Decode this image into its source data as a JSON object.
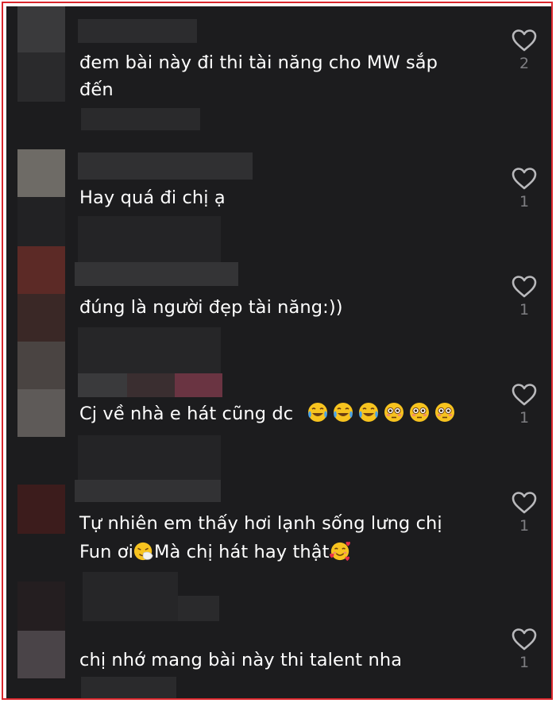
{
  "comments": [
    {
      "text": "đem bài này đi thi tài năng cho MW sắp",
      "text2": "đến",
      "likes": "2"
    },
    {
      "text": "Hay quá đi chị ạ",
      "likes": "1"
    },
    {
      "text": "đúng là người đẹp tài năng:))",
      "likes": "1"
    },
    {
      "text": "Cj về nhà e hát cũng dc",
      "likes": "1",
      "emojis": [
        "face-with-tears-of-joy",
        "face-with-tears-of-joy",
        "face-with-tears-of-joy",
        "flushed-face",
        "flushed-face",
        "flushed-face"
      ]
    },
    {
      "text": "Tự nhiên em thấy hơi lạnh sống lưng chị",
      "text2a": "Fun ơi",
      "text2b": "Mà chị hát hay thật",
      "likes": "1",
      "emojis": [
        "sneezing-face",
        "smiling-face-with-hearts"
      ]
    },
    {
      "text": "chị nhớ mang bài này thi talent nha",
      "likes": "1"
    }
  ],
  "colors": {
    "background": "#1c1c1e",
    "border": "#d9262c",
    "text": "#ffffff",
    "count": "#7e7e82"
  },
  "icons": {
    "like": "heart-outline-icon"
  }
}
